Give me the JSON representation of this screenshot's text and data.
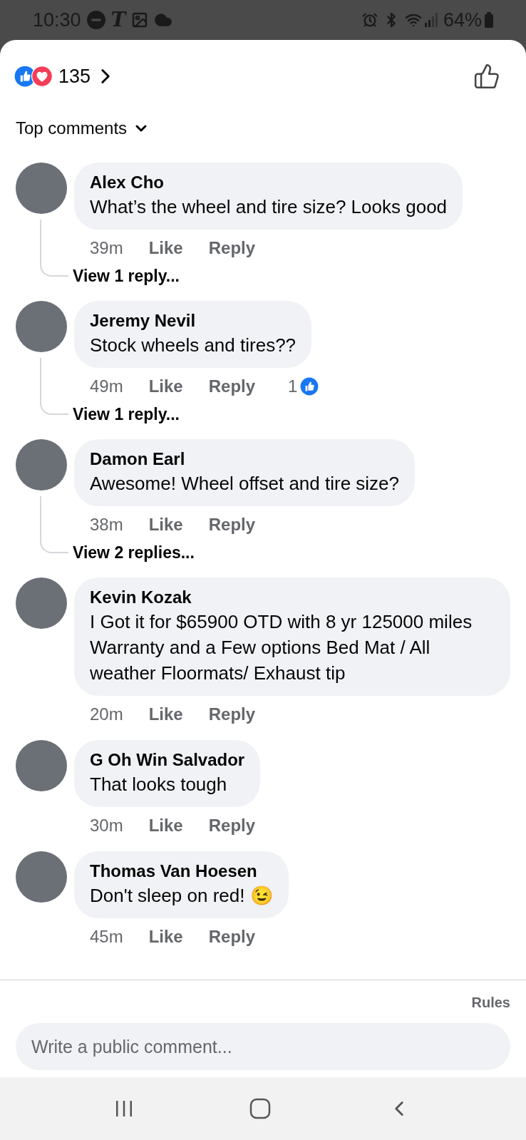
{
  "status_bar": {
    "time": "10:30",
    "notification_glyph": "T",
    "battery": "64%"
  },
  "reactions": {
    "count": "135"
  },
  "sort": {
    "label": "Top comments"
  },
  "comments": [
    {
      "author": "Alex Cho",
      "text": "What’s the wheel and tire size? Looks good",
      "time": "39m",
      "like": "Like",
      "reply": "Reply",
      "view_replies": "View 1 reply..."
    },
    {
      "author": "Jeremy Nevil",
      "text": "Stock wheels and tires??",
      "time": "49m",
      "like": "Like",
      "reply": "Reply",
      "like_count": "1",
      "view_replies": "View 1 reply..."
    },
    {
      "author": "Damon Earl",
      "text": "Awesome!  Wheel offset and tire size?",
      "time": "38m",
      "like": "Like",
      "reply": "Reply",
      "view_replies": "View 2 replies..."
    },
    {
      "author": "Kevin Kozak",
      "text": "I Got it for $65900 OTD with 8 yr 125000 miles Warranty and a Few options Bed Mat / All weather Floormats/ Exhaust tip",
      "time": "20m",
      "like": "Like",
      "reply": "Reply"
    },
    {
      "author": "G Oh Win Salvador",
      "text": "That looks tough",
      "time": "30m",
      "like": "Like",
      "reply": "Reply"
    },
    {
      "author": "Thomas Van Hoesen",
      "text": "Don't sleep on red! 😉",
      "time": "45m",
      "like": "Like",
      "reply": "Reply"
    }
  ],
  "composer": {
    "rules": "Rules",
    "placeholder": "Write a public comment..."
  }
}
